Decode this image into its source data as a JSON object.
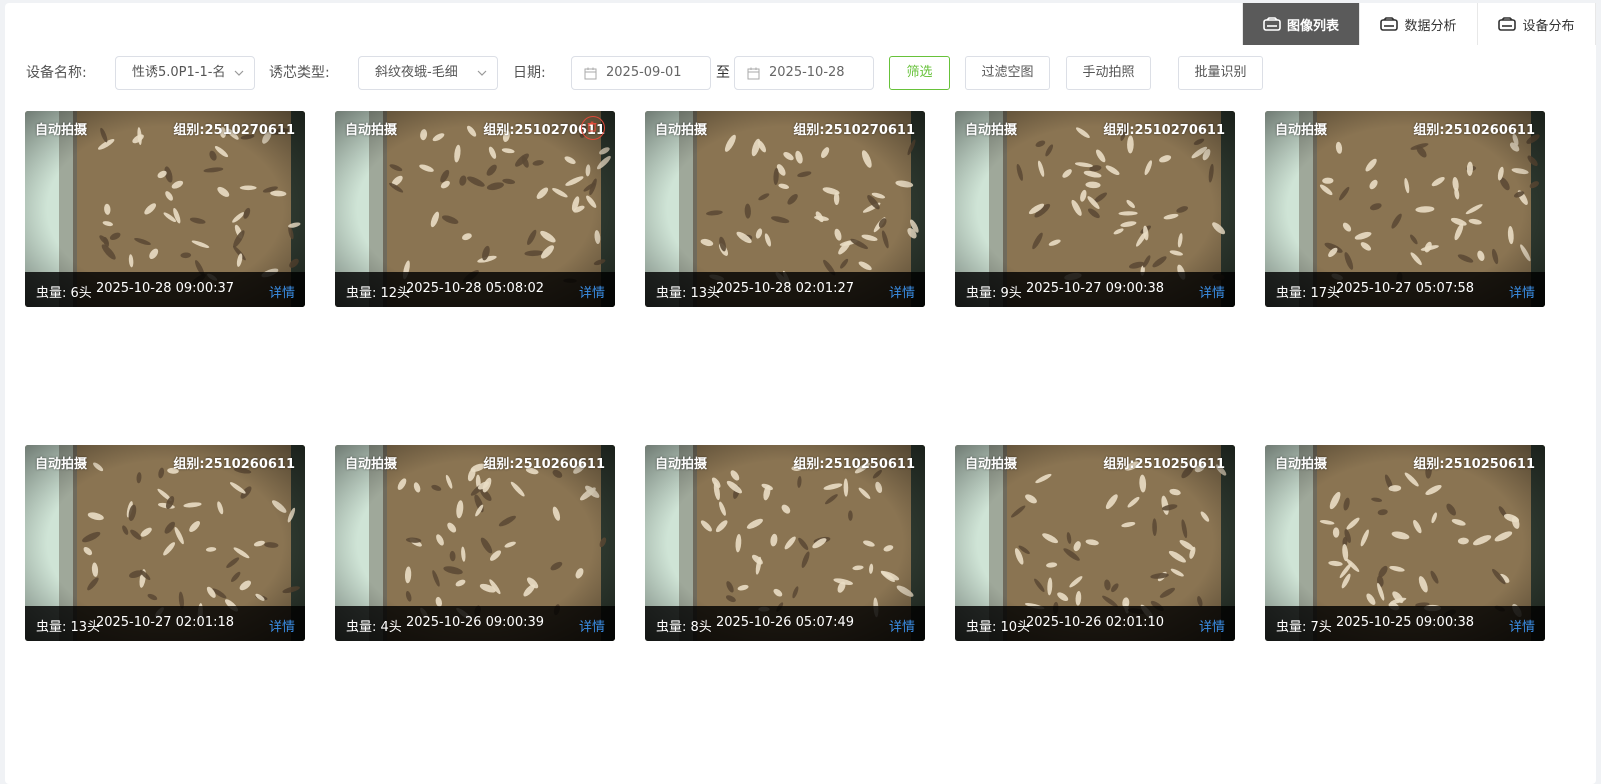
{
  "tabs": [
    {
      "label": "图像列表",
      "icon": "device-icon",
      "active": true
    },
    {
      "label": "数据分析",
      "icon": "device-icon",
      "active": false
    },
    {
      "label": "设备分布",
      "icon": "device-icon",
      "active": false
    }
  ],
  "filters": {
    "device_label": "设备名称:",
    "device_value": "性诱5.0P1-1-名",
    "lure_label": "诱芯类型:",
    "lure_value": "斜纹夜蛾-毛细",
    "date_label": "日期:",
    "date_start": "2025-09-01",
    "date_sep": "至",
    "date_end": "2025-10-28",
    "btn_filter": "筛选",
    "btn_filter_empty": "过滤空图",
    "btn_manual": "手动拍照",
    "btn_batch": "批量识别"
  },
  "colors": {
    "primary_green": "#67c23a",
    "link_blue": "#3a8ee6",
    "active_tab": "#5a5a5a",
    "delete_red": "#e04a3a"
  },
  "cards": [
    {
      "mode": "自动拍摄",
      "group": "组别:2510270611",
      "count": "虫量: 6头",
      "time": "2025-10-28 09:00:37",
      "detail": "详情",
      "delete_icon": false
    },
    {
      "mode": "自动拍摄",
      "group": "组别:2510270611",
      "count": "虫量: 12头",
      "time": "2025-10-28 05:08:02",
      "detail": "详情",
      "delete_icon": true
    },
    {
      "mode": "自动拍摄",
      "group": "组别:2510270611",
      "count": "虫量: 13头",
      "time": "2025-10-28 02:01:27",
      "detail": "详情",
      "delete_icon": false
    },
    {
      "mode": "自动拍摄",
      "group": "组别:2510270611",
      "count": "虫量: 9头",
      "time": "2025-10-27 09:00:38",
      "detail": "详情",
      "delete_icon": false
    },
    {
      "mode": "自动拍摄",
      "group": "组别:2510260611",
      "count": "虫量: 17头",
      "time": "2025-10-27 05:07:58",
      "detail": "详情",
      "delete_icon": false
    },
    {
      "mode": "自动拍摄",
      "group": "组别:2510260611",
      "count": "虫量: 13头",
      "time": "2025-10-27 02:01:18",
      "detail": "详情",
      "delete_icon": false
    },
    {
      "mode": "自动拍摄",
      "group": "组别:2510260611",
      "count": "虫量: 4头",
      "time": "2025-10-26 09:00:39",
      "detail": "详情",
      "delete_icon": false
    },
    {
      "mode": "自动拍摄",
      "group": "组别:2510250611",
      "count": "虫量: 8头",
      "time": "2025-10-26 05:07:49",
      "detail": "详情",
      "delete_icon": false
    },
    {
      "mode": "自动拍摄",
      "group": "组别:2510250611",
      "count": "虫量: 10头",
      "time": "2025-10-26 02:01:10",
      "detail": "详情",
      "delete_icon": false
    },
    {
      "mode": "自动拍摄",
      "group": "组别:2510250611",
      "count": "虫量: 7头",
      "time": "2025-10-25 09:00:38",
      "detail": "详情",
      "delete_icon": false
    }
  ]
}
